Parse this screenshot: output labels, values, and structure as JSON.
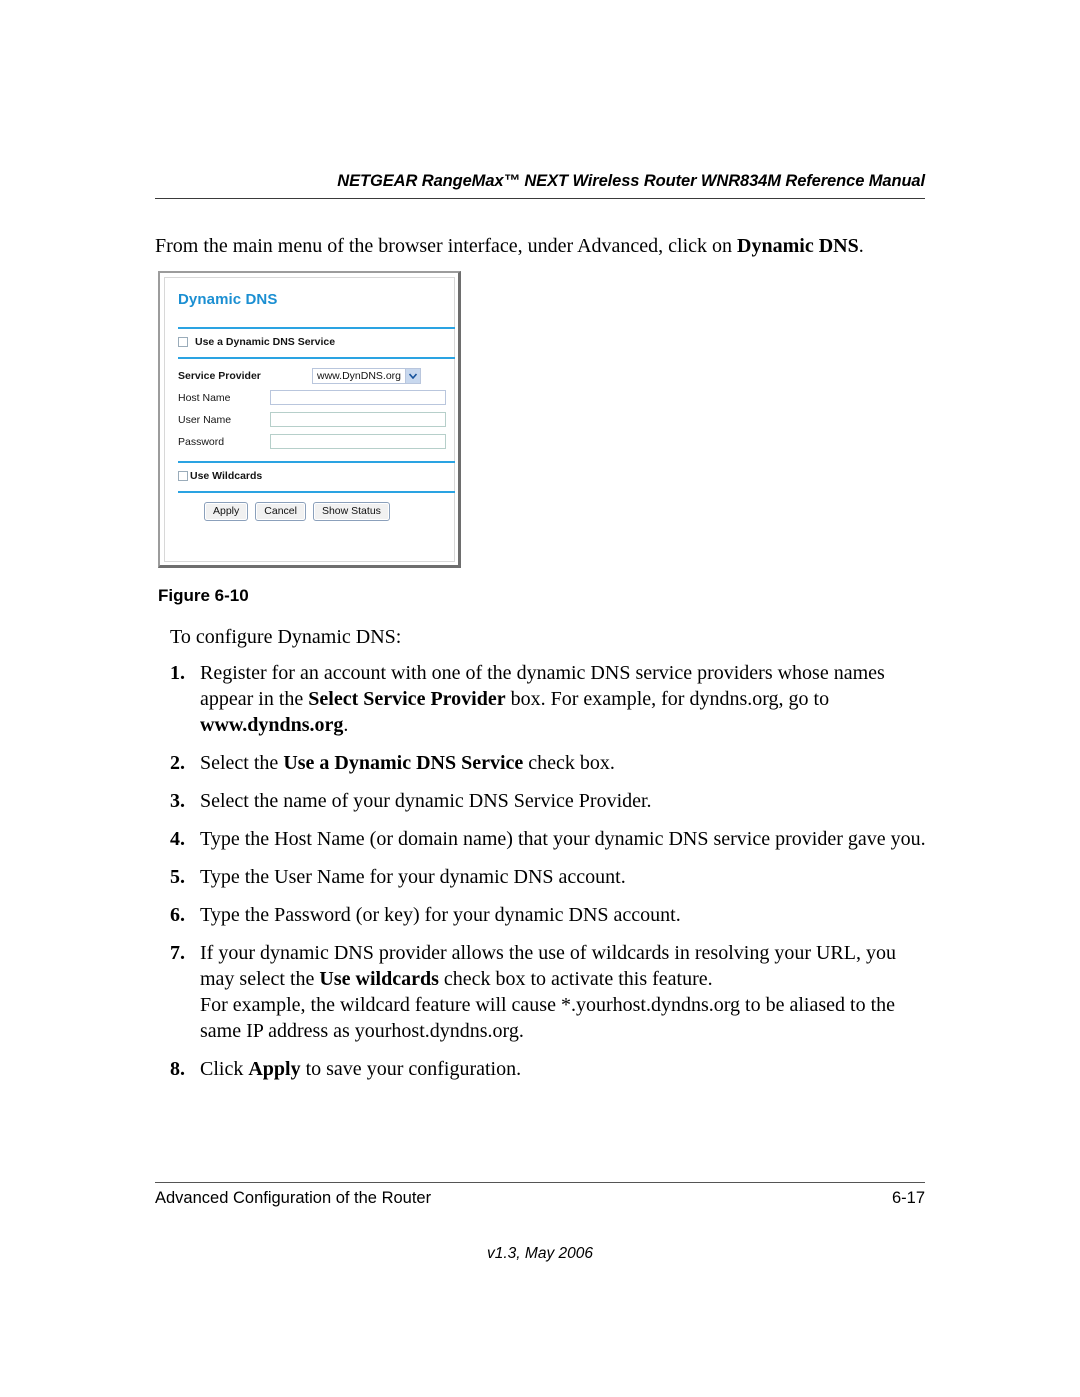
{
  "header": {
    "title": "NETGEAR RangeMax™ NEXT Wireless Router WNR834M Reference Manual"
  },
  "intro": {
    "text_before": "From the main menu of the browser interface, under Advanced, click on ",
    "bold_term": "Dynamic DNS",
    "text_after": "."
  },
  "router_ui": {
    "panel_title": "Dynamic DNS",
    "use_service_checkbox_label": "Use a Dynamic DNS Service",
    "service_provider_label": "Service Provider",
    "service_provider_value": "www.DynDNS.org",
    "host_name_label": "Host Name",
    "host_name_value": "",
    "user_name_label": "User Name",
    "user_name_value": "",
    "password_label": "Password",
    "password_value": "",
    "use_wildcards_checkbox_label": "Use Wildcards",
    "apply_button": "Apply",
    "cancel_button": "Cancel",
    "show_status_button": "Show Status",
    "accent_color": "#2aa3e2",
    "title_color": "#1b8fd2"
  },
  "figure": {
    "caption": "Figure 6-10"
  },
  "lead": {
    "text": "To configure Dynamic DNS:"
  },
  "steps": [
    {
      "num": "1.",
      "parts": [
        {
          "t": "Register for an account with one of the dynamic DNS service providers whose names appear in the ",
          "b": false
        },
        {
          "t": "Select Service Provider",
          "b": true
        },
        {
          "t": " box. For example, for dyndns.org, go to ",
          "b": false
        },
        {
          "t": "www.dyndns.org",
          "b": true
        },
        {
          "t": ".",
          "b": false
        }
      ]
    },
    {
      "num": "2.",
      "parts": [
        {
          "t": "Select the ",
          "b": false
        },
        {
          "t": "Use a Dynamic DNS Service",
          "b": true
        },
        {
          "t": " check box.",
          "b": false
        }
      ]
    },
    {
      "num": "3.",
      "parts": [
        {
          "t": "Select the name of your dynamic DNS Service Provider.",
          "b": false
        }
      ]
    },
    {
      "num": "4.",
      "parts": [
        {
          "t": "Type the Host Name (or domain name) that your dynamic DNS service provider gave you.",
          "b": false
        }
      ]
    },
    {
      "num": "5.",
      "parts": [
        {
          "t": "Type the User Name for your dynamic DNS account.",
          "b": false
        }
      ]
    },
    {
      "num": "6.",
      "parts": [
        {
          "t": "Type the Password (or key) for your dynamic DNS account.",
          "b": false
        }
      ]
    },
    {
      "num": "7.",
      "parts": [
        {
          "t": "If your dynamic DNS provider allows the use of wildcards in resolving your URL, you may select the ",
          "b": false
        },
        {
          "t": "Use wildcards",
          "b": true
        },
        {
          "t": " check box to activate this feature.",
          "b": false
        },
        {
          "t": "\n",
          "br": true
        },
        {
          "t": "For example, the wildcard feature will cause *.yourhost.dyndns.org to be aliased to the same IP address as yourhost.dyndns.org.",
          "b": false
        }
      ]
    },
    {
      "num": "8.",
      "parts": [
        {
          "t": "Click ",
          "b": false
        },
        {
          "t": "Apply",
          "b": true
        },
        {
          "t": " to save your configuration.",
          "b": false
        }
      ]
    }
  ],
  "footer": {
    "section": "Advanced Configuration of the Router",
    "page_number": "6-17",
    "version": "v1.3, May 2006"
  }
}
